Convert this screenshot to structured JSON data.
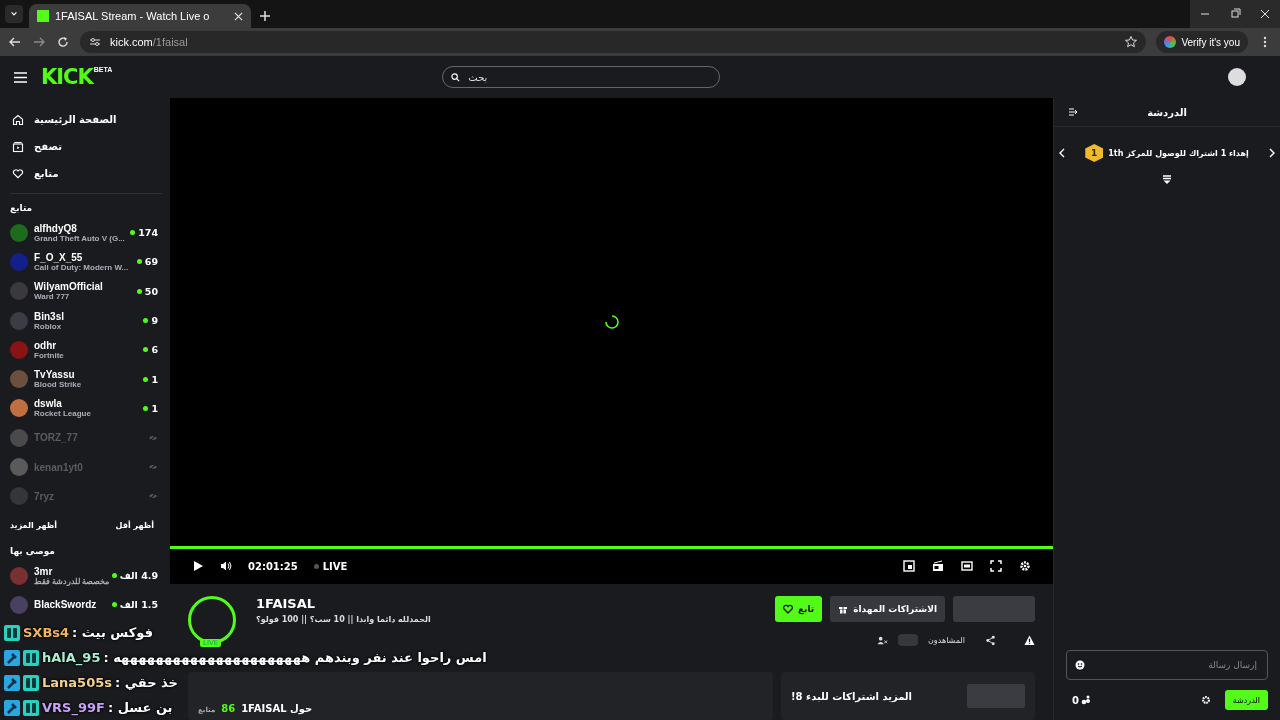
{
  "browser": {
    "tab_title": "1FAISAL Stream - Watch Live o",
    "url_host": "kick.com",
    "url_path": "/1faisal",
    "profile_button": "Verify it's you"
  },
  "header": {
    "logo": "KICK",
    "logo_badge": "BETA",
    "search_placeholder": "بحث"
  },
  "nav": [
    {
      "label": "الصفحة الرئيسية",
      "kind": "home"
    },
    {
      "label": "تصفح",
      "kind": "browse"
    },
    {
      "label": "متابع",
      "kind": "heart"
    }
  ],
  "followed": {
    "title": "متابع",
    "channels": [
      {
        "name": "alfhdyQ8",
        "category": "Grand Theft Auto V (G...",
        "viewers": "174",
        "live": true,
        "color": "#1d6b1d"
      },
      {
        "name": "F_O_X_55",
        "category": "Call of Duty: Modern W...",
        "viewers": "69",
        "live": true,
        "color": "#14208a"
      },
      {
        "name": "WilyamOfficial",
        "category": "Ward 777",
        "viewers": "50",
        "live": true,
        "color": "#3a3a3e"
      },
      {
        "name": "Bin3sl",
        "category": "Roblox",
        "viewers": "9",
        "live": true,
        "color": "#3a3d44"
      },
      {
        "name": "odhr",
        "category": "Fortnite",
        "viewers": "6",
        "live": true,
        "color": "#8a1414"
      },
      {
        "name": "TvYassu",
        "category": "Blood Strike",
        "viewers": "1",
        "live": true,
        "color": "#6b5040"
      },
      {
        "name": "dswla",
        "category": "Rocket League",
        "viewers": "1",
        "live": true,
        "color": "#c07040"
      },
      {
        "name": "TORZ_77",
        "live": false,
        "color": "#4a4a4a"
      },
      {
        "name": "kenan1yt0",
        "live": false,
        "color": "#5a5a5a"
      },
      {
        "name": "7ryz",
        "live": false,
        "color": "#35353a"
      }
    ],
    "show_more": "أظهر المزيد",
    "show_less": "أظهر أقل"
  },
  "recommended": {
    "title": "موصى بها",
    "channels": [
      {
        "name": "3mr",
        "category": "مخصصة للدردشة فقط",
        "viewers": "4.9 الف",
        "color": "#7a3030"
      },
      {
        "name": "BlackSwordz",
        "viewers": "1.5 الف",
        "color": "#4a4060"
      }
    ]
  },
  "player": {
    "level": 1,
    "time": "02:01:25",
    "live_label": "LIVE"
  },
  "channel": {
    "name": "1FAISAL",
    "live_badge": "LIVE",
    "title": "الحمدلله دائما وابدا || 10 سب؟ || 100 فولو؟",
    "follow": "تابع",
    "viewers_on": false,
    "gift": "الاشتراكات المهداة",
    "viewers_label": "المشاهدون"
  },
  "about": {
    "title": "حول 1FAISAL",
    "followers": "86",
    "followers_label": "متابع"
  },
  "subs_card": {
    "text": "!المزيد اشتراكات للبدء 8"
  },
  "chat": {
    "title": "الدردشة",
    "goal": {
      "badge": "1",
      "text": "إهداء 1 اشتراك للوصول للمركز 1th"
    },
    "input_placeholder": "إرسال رسالة",
    "chat_button": "الدردشة",
    "points": "0"
  },
  "overlay_messages": [
    {
      "user": "SXBs4",
      "color": "#f2b45c",
      "moderator": false,
      "subscriber": true,
      "text": ": فوكس بيث"
    },
    {
      "user": "hAlA_95",
      "color": "#a8f0d0",
      "moderator": true,
      "subscriber": true,
      "text": ": امس راحوا عند نفر وبندهم ههههههههههههههههههههههه"
    },
    {
      "user": "Lana505s",
      "color": "#f5d08a",
      "moderator": true,
      "subscriber": true,
      "text": ": خذ حقي"
    },
    {
      "user": "VRS_99F",
      "color": "#c9a0f8",
      "moderator": true,
      "subscriber": true,
      "text": ": بن عسل"
    }
  ]
}
